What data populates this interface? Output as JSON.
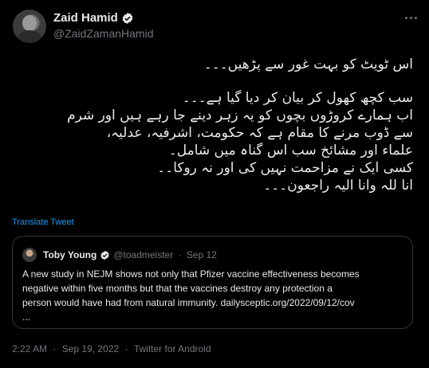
{
  "author": {
    "display_name": "Zaid Hamid",
    "handle": "@ZaidZamanHamid",
    "verified_icon": "verified-badge-icon"
  },
  "tweet": {
    "lines": [
      "اس ٹویٹ کو بہت غور سے پڑھیں۔۔۔",
      "",
      "سب کچھ کھول کر بیان کر دیا گیا ہے۔۔۔",
      "اب ہمارے کروڑوں بچوں کو یہ زہر دینے جا رہے ہیں اور شرم",
      "سے ڈوب مرنے کا مقام ہے کہ حکومت، اشرفیہ، عدلیہ،",
      "علماء اور مشائخ سب اس گناہ میں شامل۔",
      "کسی ایک نے مزاحمت نہیں کی اور نہ روکا۔۔",
      "انا للہ وانا الیہ راجعون۔۔۔"
    ],
    "translate_label": "Translate Tweet"
  },
  "quote": {
    "display_name": "Toby Young",
    "handle": "@toadmeister",
    "separator": "·",
    "date": "Sep 12",
    "lines": [
      "A new study in NEJM shows not only that Pfizer vaccine effectiveness becomes",
      "negative within five months but that the vaccines destroy any protection a",
      "person would have had from natural immunity. dailysceptic.org/2022/09/12/cov",
      "..."
    ]
  },
  "footer": {
    "time": "2:22 AM",
    "sep1": "·",
    "date": "Sep 19, 2022",
    "sep2": "·",
    "source": "Twitter for Android"
  },
  "colors": {
    "background": "#000000",
    "text": "#e7e9ea",
    "muted": "#71767b",
    "accent": "#1d9bf0",
    "border": "#333639"
  }
}
